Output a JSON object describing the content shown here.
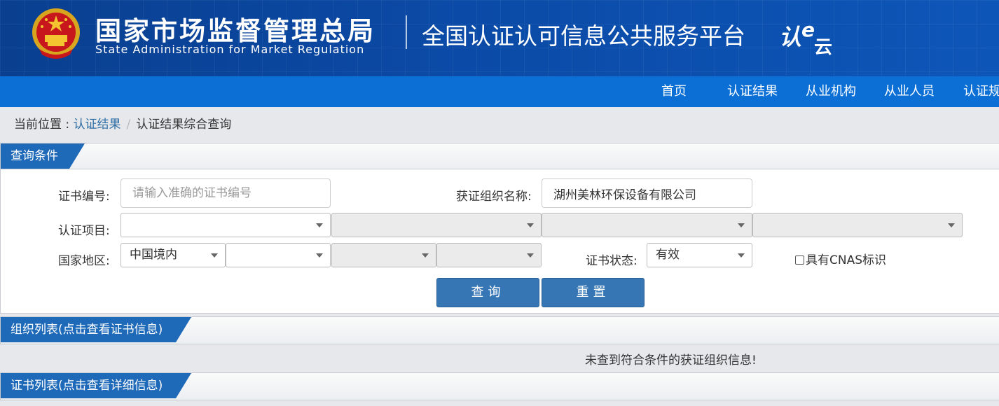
{
  "header": {
    "org_name_cn": "国家市场监督管理总局",
    "org_name_en": "State Administration  for  Market Regulation",
    "platform_title": "全国认证认可信息公共服务平台",
    "platform_logo_text": "认e云"
  },
  "nav": {
    "items": [
      {
        "label": "首页"
      },
      {
        "label": "认证结果"
      },
      {
        "label": "从业机构"
      },
      {
        "label": "从业人员"
      },
      {
        "label": "认证规"
      }
    ]
  },
  "breadcrumb": {
    "prefix": "当前位置 : ",
    "link": "认证结果",
    "separator": "/",
    "current": "认证结果综合查询"
  },
  "query_panel": {
    "title": "查询条件",
    "cert_no_label": "证书编号:",
    "cert_no_value": "",
    "cert_no_placeholder": "请输入准确的证书编号",
    "org_name_label": "获证组织名称:",
    "org_name_value": "湖州美林环保设备有限公司",
    "project_label": "认证项目:",
    "project_selects": [
      "",
      "",
      "",
      ""
    ],
    "region_label": "国家地区:",
    "region_selects": [
      "中国境内",
      "",
      "",
      ""
    ],
    "status_label": "证书状态:",
    "status_value": "有效",
    "cnas_label": "具有CNAS标识",
    "query_button": "查询",
    "reset_button": "重置"
  },
  "org_list": {
    "title": "组织列表(点击查看证书信息)",
    "empty_message": "未查到符合条件的获证组织信息!"
  },
  "cert_list": {
    "title": "证书列表(点击查看详细信息)"
  },
  "colors": {
    "header_bg": "#0b4aa6",
    "nav_bg": "#0b6fd6",
    "tag_bg": "#1f69b9",
    "button_bg": "#3676b5",
    "link": "#2e6da4"
  }
}
